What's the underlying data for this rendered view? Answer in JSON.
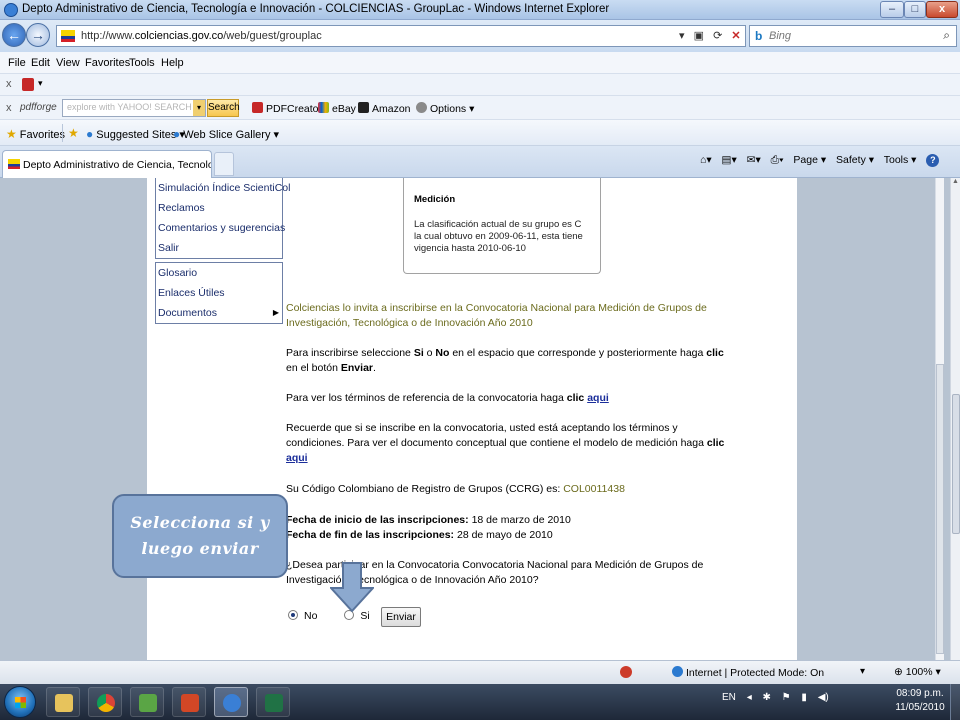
{
  "window": {
    "title": "Depto Administrativo de Ciencia, Tecnología e Innovación - COLCIENCIAS - GroupLac - Windows Internet Explorer",
    "min_label": "–",
    "max_label": "□",
    "close_label": "x"
  },
  "address": {
    "url_prefix": "http://www.",
    "url_host": "colciencias.gov.co",
    "url_path": "/web/guest/grouplac",
    "search_placeholder": "Bing"
  },
  "menu": [
    "File",
    "Edit",
    "View",
    "Favorites",
    "Tools",
    "Help"
  ],
  "toolbar2": {
    "brand": "pdfforge",
    "yahoo_placeholder": "explore with YAHOO! SEARCH",
    "search_button": "Search",
    "items": [
      "PDFCreator",
      "eBay",
      "Amazon",
      "Options ▾"
    ]
  },
  "favorites": {
    "favorites_label": "Favorites",
    "suggested": "Suggested Sites ▾",
    "webslice": "Web Slice Gallery ▾"
  },
  "tab": {
    "label": "Depto Administrativo de Ciencia, Tecnología e In..."
  },
  "commandbar": {
    "page": "Page ▾",
    "safety": "Safety ▾",
    "tools": "Tools ▾"
  },
  "leftmenu": {
    "group1": [
      "Simulación Índice ScientiCol",
      "Reclamos",
      "Comentarios y sugerencias",
      "Salir"
    ],
    "group2": [
      "Glosario",
      "Enlaces Útiles",
      "Documentos"
    ]
  },
  "medicion": {
    "title": "Medición",
    "text": "La clasificación actual de su grupo es C la cual obtuvo en 2009-06-11, esta tiene vigencia hasta 2010-06-10"
  },
  "content": {
    "invite": "Colciencias lo invita a inscribirse en la Convocatoria Nacional para Medición de Grupos de Investigación, Tecnológica o de Innovación Año 2010",
    "p1_a": "Para inscribirse seleccione ",
    "p1_si": "Si",
    "p1_b": " o ",
    "p1_no": "No",
    "p1_c": " en el espacio que corresponde y posteriormente haga ",
    "p1_clic": "clic",
    "p1_d": " en el botón ",
    "p1_enviar": "Enviar",
    "p1_e": ".",
    "p2_a": "Para ver los términos de referencia de la convocatoria haga ",
    "p2_clic": "clic",
    "p2_link": "aqui",
    "p3_a": "Recuerde que si se inscribe en la convocatoria, usted está aceptando los términos y condiciones. Para ver el documento conceptual que contiene el modelo de medición haga ",
    "p3_clic": "clic",
    "p3_link": "aqui",
    "p4_a": "Su Código Colombiano de Registro de Grupos (CCRG) es: ",
    "p4_code": "COL0011438",
    "p5_label1": "Fecha de inicio de las inscripciones:",
    "p5_val1": " 18 de marzo de 2010",
    "p5_label2": "Fecha de fin de las inscripciones:",
    "p5_val2": " 28 de mayo de 2010",
    "p6": "¿Desea participar en la Convocatoria Convocatoria Nacional para Medición de Grupos de Investigación, Tecnológica o de Innovación Año 2010?",
    "radio_no": "No",
    "radio_si": "Si",
    "selected": "No",
    "button": "Enviar"
  },
  "callout": {
    "line1": "Selecciona si y",
    "line2": "luego enviar"
  },
  "status": {
    "zone": "Internet | Protected Mode: On",
    "zoom": "100%"
  },
  "taskbar": {
    "lang": "EN",
    "time": "08:09 p.m.",
    "date": "11/05/2010"
  },
  "colors": {
    "accent": "#1a2d9a",
    "invite_text": "#6b6b1d",
    "callout_bg": "#8ca9cf"
  }
}
